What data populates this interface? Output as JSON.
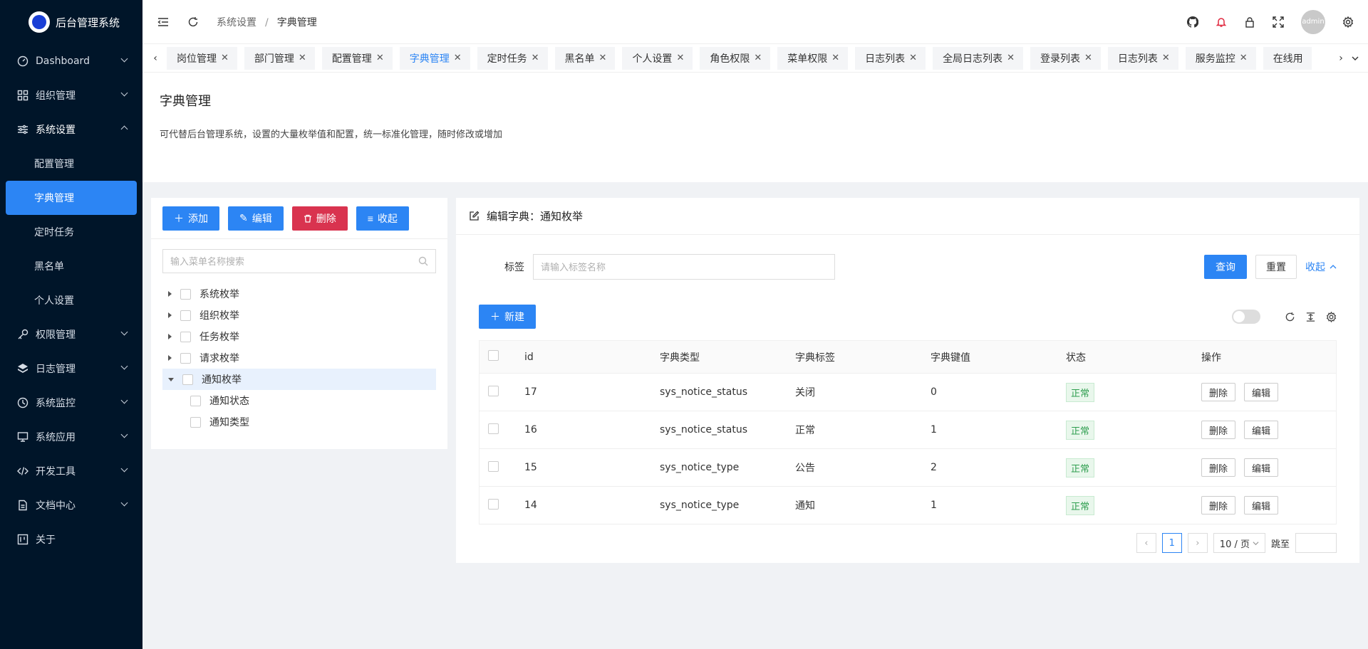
{
  "app": {
    "title": "后台管理系统"
  },
  "sidebar": {
    "items": [
      {
        "label": "Dashboard",
        "icon": "dashboard-icon"
      },
      {
        "label": "组织管理",
        "icon": "grid-icon"
      },
      {
        "label": "系统设置",
        "icon": "sliders-icon",
        "open": true,
        "children": [
          "配置管理",
          "字典管理",
          "定时任务",
          "黑名单",
          "个人设置"
        ],
        "active_child": "字典管理"
      },
      {
        "label": "权限管理",
        "icon": "key-icon"
      },
      {
        "label": "日志管理",
        "icon": "layers-icon"
      },
      {
        "label": "系统监控",
        "icon": "monitor-clock-icon"
      },
      {
        "label": "系统应用",
        "icon": "screen-icon"
      },
      {
        "label": "开发工具",
        "icon": "code-icon"
      },
      {
        "label": "文档中心",
        "icon": "file-icon"
      },
      {
        "label": "关于",
        "icon": "trello-icon"
      }
    ]
  },
  "header": {
    "breadcrumb": [
      "系统设置",
      "字典管理"
    ],
    "avatar": "admin"
  },
  "tabs": [
    "岗位管理",
    "部门管理",
    "配置管理",
    "字典管理",
    "定时任务",
    "黑名单",
    "个人设置",
    "角色权限",
    "菜单权限",
    "日志列表",
    "全局日志列表",
    "登录列表",
    "日志列表",
    "服务监控",
    "在线用"
  ],
  "active_tab": "字典管理",
  "page": {
    "title": "字典管理",
    "description": "可代替后台管理系统，设置的大量枚举值和配置，统一标准化管理，随时修改或增加"
  },
  "left_panel": {
    "buttons": {
      "add": "添加",
      "edit": "编辑",
      "delete": "删除",
      "collapse": "收起"
    },
    "search_placeholder": "输入菜单名称搜索",
    "tree": [
      {
        "label": "系统枚举",
        "expanded": false
      },
      {
        "label": "组织枚举",
        "expanded": false
      },
      {
        "label": "任务枚举",
        "expanded": false
      },
      {
        "label": "请求枚举",
        "expanded": false
      },
      {
        "label": "通知枚举",
        "expanded": true,
        "selected": true,
        "children": [
          "通知状态",
          "通知类型"
        ]
      }
    ]
  },
  "right_panel": {
    "title": "编辑字典：通知枚举",
    "filter": {
      "label": "标签",
      "placeholder": "请输入标签名称",
      "query": "查询",
      "reset": "重置",
      "collapse": "收起"
    },
    "new_button": "新建",
    "columns": [
      "id",
      "字典类型",
      "字典标签",
      "字典键值",
      "状态",
      "操作"
    ],
    "rows": [
      {
        "id": "17",
        "type": "sys_notice_status",
        "label": "关闭",
        "value": "0",
        "status": "正常"
      },
      {
        "id": "16",
        "type": "sys_notice_status",
        "label": "正常",
        "value": "1",
        "status": "正常"
      },
      {
        "id": "15",
        "type": "sys_notice_type",
        "label": "公告",
        "value": "2",
        "status": "正常"
      },
      {
        "id": "14",
        "type": "sys_notice_type",
        "label": "通知",
        "value": "1",
        "status": "正常"
      }
    ],
    "row_actions": {
      "delete": "删除",
      "edit": "编辑"
    },
    "pagination": {
      "current": "1",
      "page_size": "10 / 页",
      "jump_label": "跳至"
    }
  },
  "colors": {
    "primary": "#2c85f4",
    "danger": "#d9334f",
    "sidebar": "#001529",
    "success": "#2e9e4f"
  }
}
